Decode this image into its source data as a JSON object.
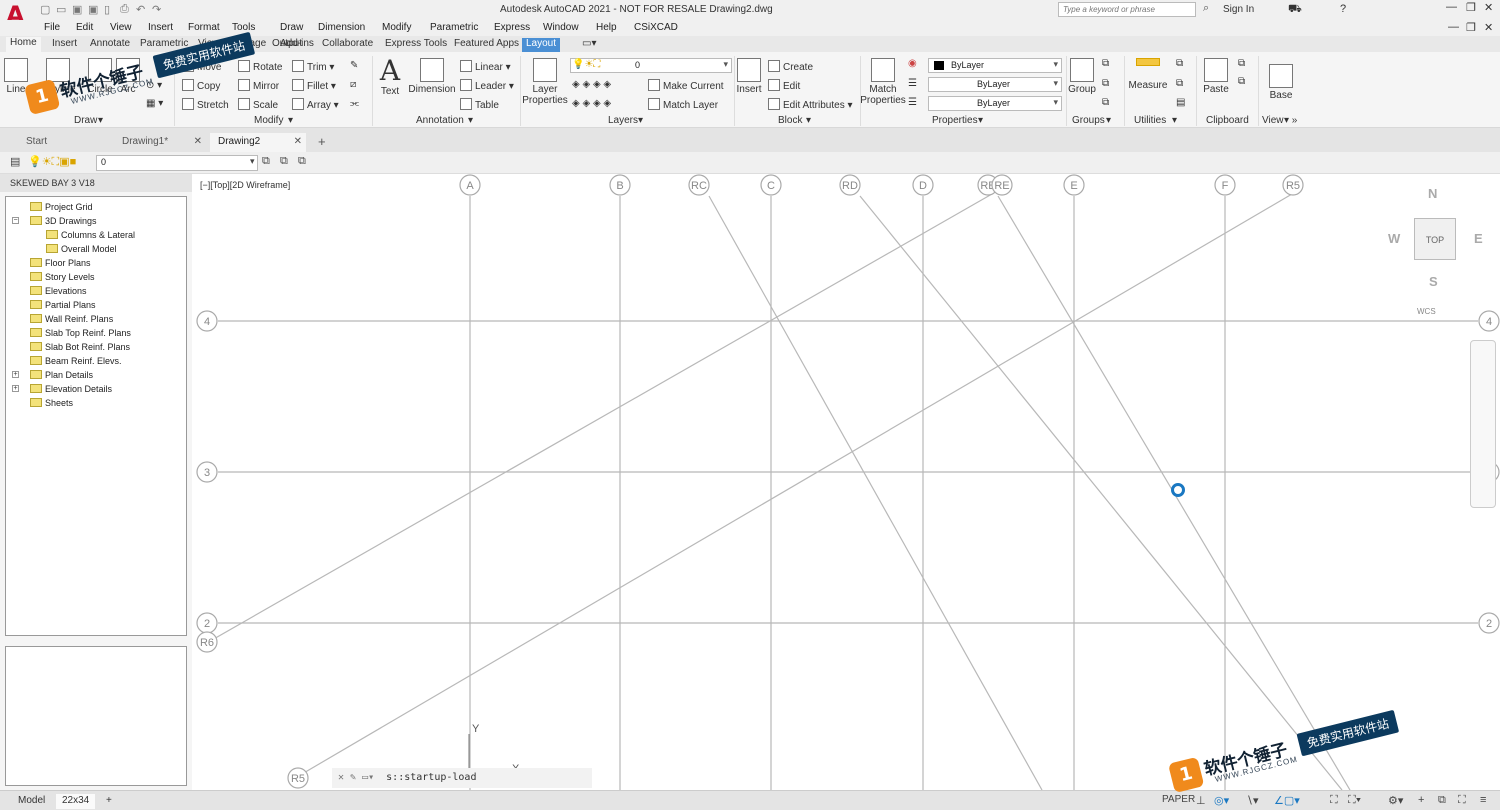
{
  "app": {
    "title": "Autodesk AutoCAD 2021 - NOT FOR RESALE   Drawing2.dwg",
    "logo_letter": "A",
    "search_placeholder": "Type a keyword or phrase",
    "sign_in": "Sign In"
  },
  "menu": [
    "File",
    "Edit",
    "View",
    "Insert",
    "Format",
    "Tools",
    "Draw",
    "Dimension",
    "Modify",
    "Parametric",
    "Express",
    "Window",
    "Help",
    "CSiXCAD"
  ],
  "ribbon_tabs": [
    "Home",
    "Insert",
    "Annotate",
    "Parametric",
    "View",
    "Manage",
    "Output",
    "Add-ins",
    "Collaborate",
    "Express Tools",
    "Featured Apps",
    "Layout"
  ],
  "ribbon": {
    "draw": {
      "panel": "Draw",
      "line": "Line",
      "polyline": "Polyline",
      "circle": "Circle",
      "arc": "Arc"
    },
    "modify": {
      "panel": "Modify",
      "move": "Move",
      "rotate": "Rotate",
      "trim": "Trim",
      "copy": "Copy",
      "mirror": "Mirror",
      "fillet": "Fillet",
      "stretch": "Stretch",
      "scale": "Scale",
      "array": "Array"
    },
    "annotation": {
      "panel": "Annotation",
      "text": "Text",
      "dimension": "Dimension",
      "linear": "Linear",
      "leader": "Leader",
      "table": "Table"
    },
    "layers": {
      "panel": "Layers",
      "layer_properties": "Layer Properties",
      "current_layer": "0",
      "make_current": "Make Current",
      "match_layer": "Match Layer"
    },
    "block": {
      "panel": "Block",
      "insert": "Insert",
      "create": "Create",
      "edit": "Edit",
      "edit_attributes": "Edit Attributes"
    },
    "properties": {
      "panel": "Properties",
      "match_properties": "Match Properties",
      "color": "ByLayer",
      "linetype": "ByLayer",
      "lineweight": "ByLayer"
    },
    "groups": {
      "panel": "Groups",
      "group": "Group"
    },
    "utilities": {
      "panel": "Utilities",
      "measure": "Measure"
    },
    "clipboard": {
      "panel": "Clipboard",
      "paste": "Paste"
    },
    "view": {
      "panel": "View",
      "base": "Base"
    }
  },
  "doc_tabs": [
    "Start",
    "Drawing1*",
    "Drawing2"
  ],
  "layer_bar": {
    "current": "0"
  },
  "project_panel": {
    "title": "SKEWED BAY 3 V18",
    "tree": [
      {
        "label": "Project Grid",
        "level": 1,
        "expander": ""
      },
      {
        "label": "3D Drawings",
        "level": 1,
        "expander": "−"
      },
      {
        "label": "Columns & Lateral",
        "level": 2,
        "expander": ""
      },
      {
        "label": "Overall Model",
        "level": 2,
        "expander": ""
      },
      {
        "label": "Floor Plans",
        "level": 1,
        "expander": ""
      },
      {
        "label": "Story Levels",
        "level": 1,
        "expander": ""
      },
      {
        "label": "Elevations",
        "level": 1,
        "expander": ""
      },
      {
        "label": "Partial Plans",
        "level": 1,
        "expander": ""
      },
      {
        "label": "Wall Reinf. Plans",
        "level": 1,
        "expander": ""
      },
      {
        "label": "Slab Top Reinf. Plans",
        "level": 1,
        "expander": ""
      },
      {
        "label": "Slab Bot Reinf. Plans",
        "level": 1,
        "expander": ""
      },
      {
        "label": "Beam Reinf. Elevs.",
        "level": 1,
        "expander": ""
      },
      {
        "label": "Plan Details",
        "level": 1,
        "expander": "+"
      },
      {
        "label": "Elevation Details",
        "level": 1,
        "expander": "+"
      },
      {
        "label": "Sheets",
        "level": 1,
        "expander": ""
      }
    ]
  },
  "viewport": {
    "label": "[−][Top][2D Wireframe]"
  },
  "viewcube": {
    "face": "TOP",
    "north": "N",
    "south": "S",
    "east": "E",
    "west": "W",
    "wcs": "WCS"
  },
  "grid": {
    "columns": [
      "A",
      "B",
      "RC",
      "C",
      "RD",
      "D",
      "RE",
      "RE",
      "E",
      "F",
      "R5"
    ],
    "rows": [
      "4",
      "3",
      "2"
    ],
    "other_bubbles": [
      "R6",
      "R5"
    ],
    "ucs_y": "Y",
    "ucs_x": "X"
  },
  "command_line": {
    "text": "s::startup-load"
  },
  "status": {
    "model_tab": "Model",
    "layout_tab": "22x34",
    "paper": "PAPER"
  },
  "watermark": {
    "name": "软件个锤子",
    "url": "WWW.RJGCZ.COM",
    "slogan": "免费实用软件站"
  },
  "colors": {
    "accent": "#4a8fd4",
    "grid_line": "#b8b8b8",
    "brand_red": "#c8102e",
    "cursor": "#1a78c2"
  }
}
